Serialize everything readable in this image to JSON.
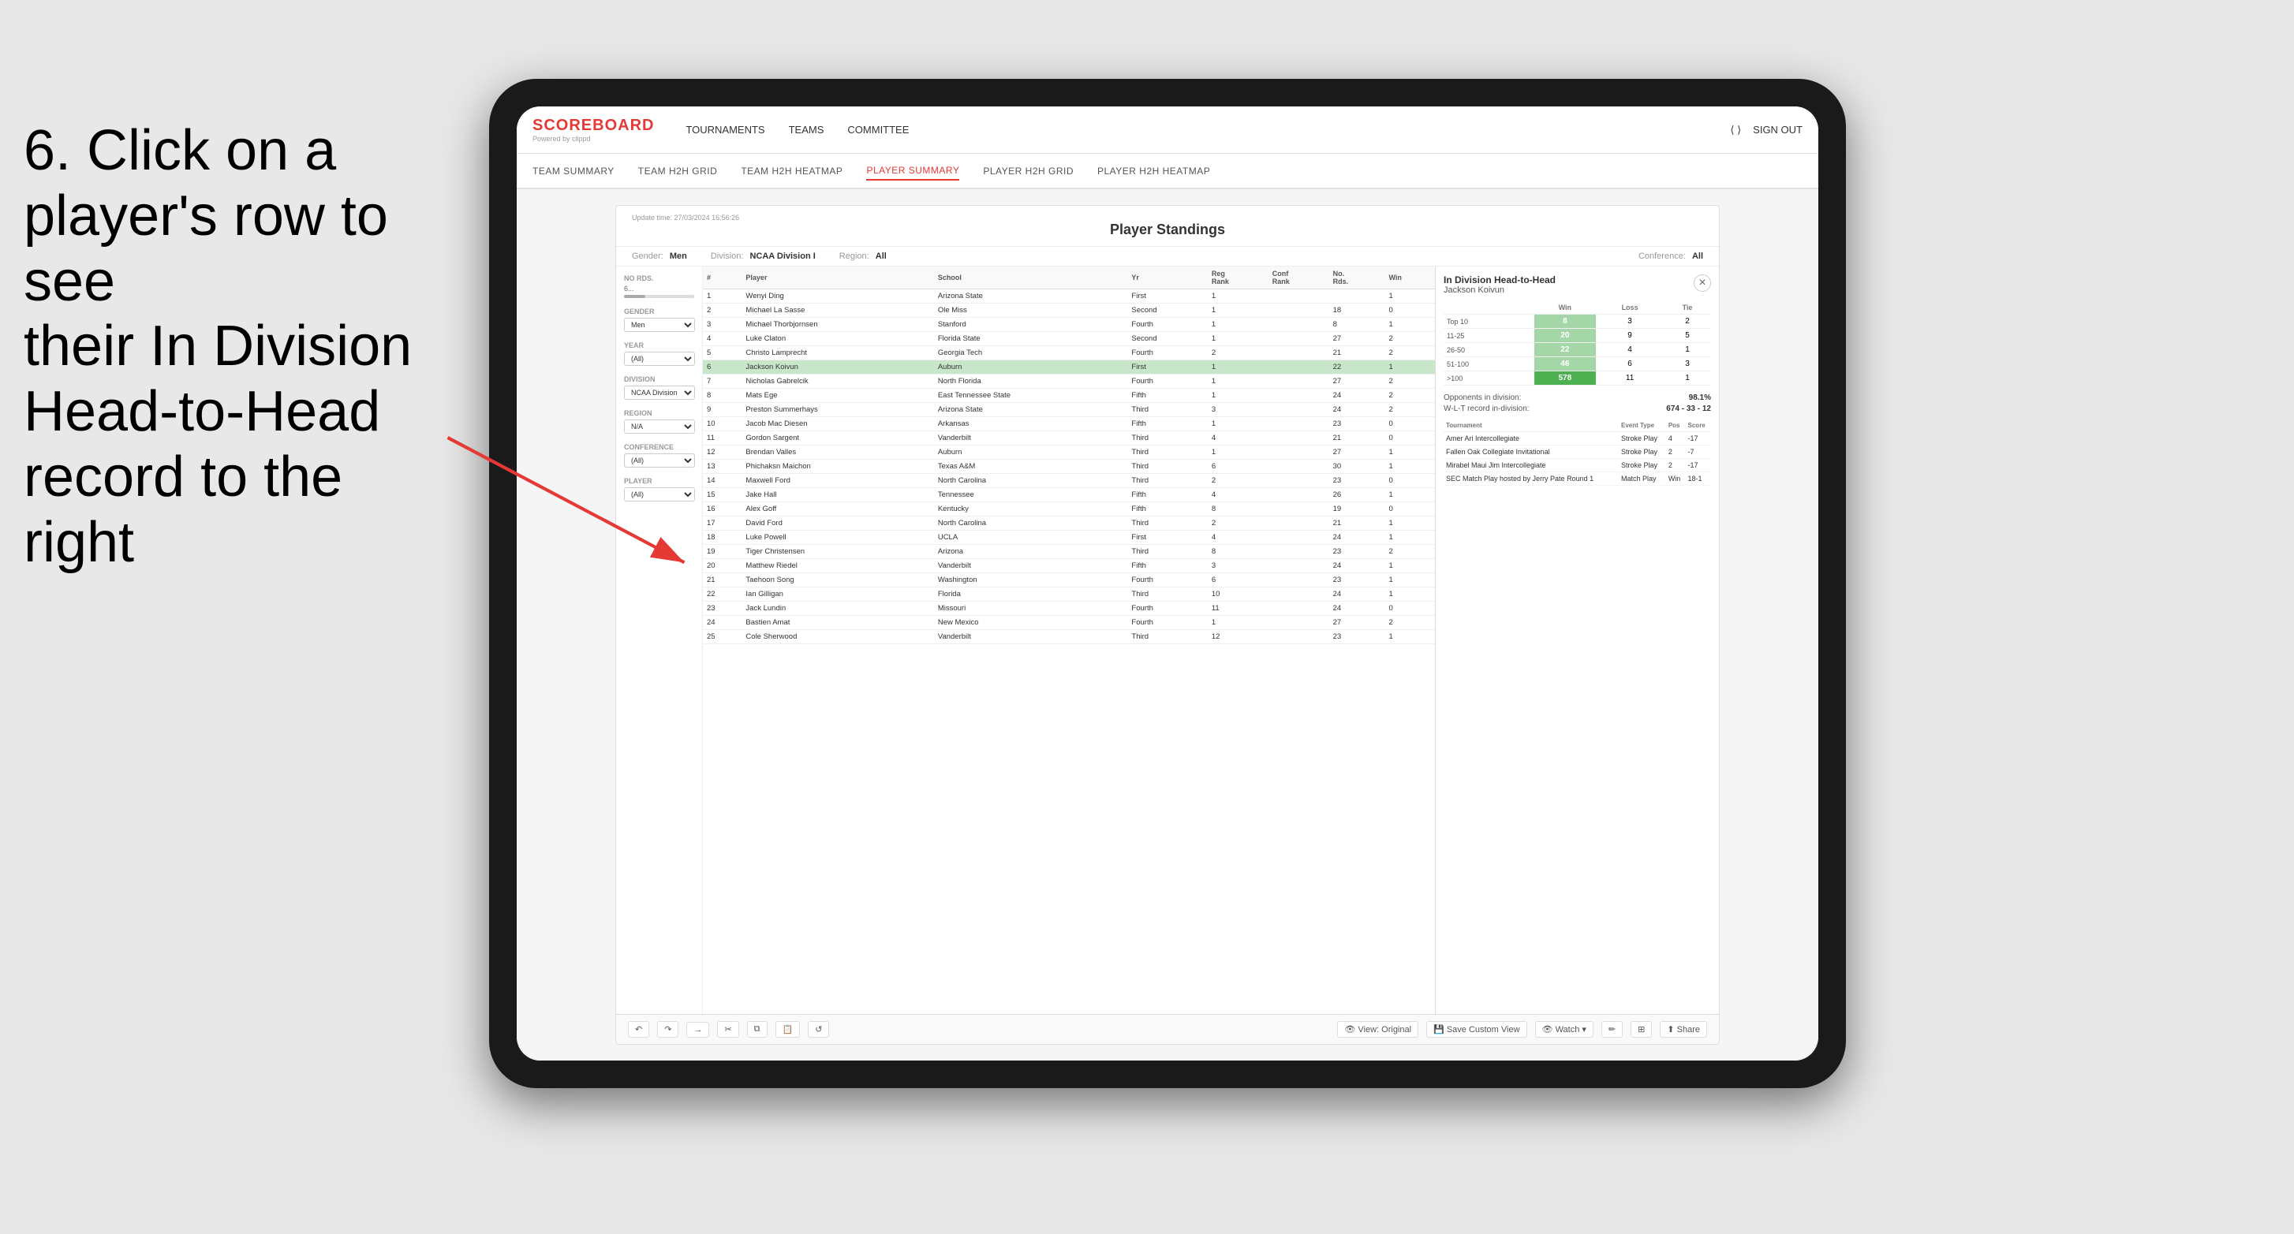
{
  "instruction": {
    "line1": "6. Click on a",
    "line2": "player's row to see",
    "line3": "their In Division",
    "line4": "Head-to-Head",
    "line5": "record to the right"
  },
  "scoreboard": {
    "title": "SCOREBOARD",
    "subtitle": "Powered by clippd"
  },
  "nav": {
    "links": [
      "TOURNAMENTS",
      "TEAMS",
      "COMMITTEE"
    ],
    "sign_out": "Sign out"
  },
  "sub_nav": {
    "links": [
      "TEAM SUMMARY",
      "TEAM H2H GRID",
      "TEAM H2H HEATMAP",
      "PLAYER SUMMARY",
      "PLAYER H2H GRID",
      "PLAYER H2H HEATMAP"
    ]
  },
  "panel": {
    "update_time_label": "Update time:",
    "update_time": "27/03/2024 16:56:26",
    "title": "Player Standings",
    "filters": {
      "gender_label": "Gender:",
      "gender": "Men",
      "division_label": "Division:",
      "division": "NCAA Division I",
      "region_label": "Region:",
      "region": "All",
      "conference_label": "Conference:",
      "conference": "All"
    }
  },
  "sidebar_filters": {
    "no_rds_label": "No Rds.",
    "no_rds_range": "6...",
    "gender_label": "Gender",
    "gender_value": "Men",
    "year_label": "Year",
    "year_value": "(All)",
    "division_label": "Division",
    "division_value": "NCAA Division I",
    "region_label": "Region",
    "region_value": "N/A",
    "conference_label": "Conference",
    "conference_value": "(All)",
    "player_label": "Player",
    "player_value": "(All)"
  },
  "table": {
    "headers": [
      "#",
      "Player",
      "School",
      "Yr",
      "Reg Rank",
      "Conf Rank",
      "No. Rds.",
      "Win"
    ],
    "rows": [
      {
        "rank": 1,
        "player": "Wenyi Ding",
        "school": "Arizona State",
        "yr": "First",
        "reg_rank": 1,
        "conf_rank": "",
        "no_rds": "",
        "win": 1
      },
      {
        "rank": 2,
        "player": "Michael La Sasse",
        "school": "Ole Miss",
        "yr": "Second",
        "reg_rank": 1,
        "conf_rank": "",
        "no_rds": 18,
        "win": 0
      },
      {
        "rank": 3,
        "player": "Michael Thorbjornsen",
        "school": "Stanford",
        "yr": "Fourth",
        "reg_rank": 1,
        "conf_rank": "",
        "no_rds": 8,
        "win": 1
      },
      {
        "rank": 4,
        "player": "Luke Claton",
        "school": "Florida State",
        "yr": "Second",
        "reg_rank": 1,
        "conf_rank": "",
        "no_rds": 27,
        "win": 2
      },
      {
        "rank": 5,
        "player": "Christo Lamprecht",
        "school": "Georgia Tech",
        "yr": "Fourth",
        "reg_rank": 2,
        "conf_rank": "",
        "no_rds": 21,
        "win": 2
      },
      {
        "rank": 6,
        "player": "Jackson Koivun",
        "school": "Auburn",
        "yr": "First",
        "reg_rank": 1,
        "conf_rank": "",
        "no_rds": 22,
        "win": 1
      },
      {
        "rank": 7,
        "player": "Nicholas Gabrelcik",
        "school": "North Florida",
        "yr": "Fourth",
        "reg_rank": 1,
        "conf_rank": "",
        "no_rds": 27,
        "win": 2
      },
      {
        "rank": 8,
        "player": "Mats Ege",
        "school": "East Tennessee State",
        "yr": "Fifth",
        "reg_rank": 1,
        "conf_rank": "",
        "no_rds": 24,
        "win": 2
      },
      {
        "rank": 9,
        "player": "Preston Summerhays",
        "school": "Arizona State",
        "yr": "Third",
        "reg_rank": 3,
        "conf_rank": "",
        "no_rds": 24,
        "win": 2
      },
      {
        "rank": 10,
        "player": "Jacob Mac Diesen",
        "school": "Arkansas",
        "yr": "Fifth",
        "reg_rank": 1,
        "conf_rank": "",
        "no_rds": 23,
        "win": 0
      },
      {
        "rank": 11,
        "player": "Gordon Sargent",
        "school": "Vanderbilt",
        "yr": "Third",
        "reg_rank": 4,
        "conf_rank": "",
        "no_rds": 21,
        "win": 0
      },
      {
        "rank": 12,
        "player": "Brendan Valles",
        "school": "Auburn",
        "yr": "Third",
        "reg_rank": 1,
        "conf_rank": "",
        "no_rds": 27,
        "win": 1
      },
      {
        "rank": 13,
        "player": "Phichaksn Maichon",
        "school": "Texas A&M",
        "yr": "Third",
        "reg_rank": 6,
        "conf_rank": "",
        "no_rds": 30,
        "win": 1
      },
      {
        "rank": 14,
        "player": "Maxwell Ford",
        "school": "North Carolina",
        "yr": "Third",
        "reg_rank": 2,
        "conf_rank": "",
        "no_rds": 23,
        "win": 0
      },
      {
        "rank": 15,
        "player": "Jake Hall",
        "school": "Tennessee",
        "yr": "Fifth",
        "reg_rank": 4,
        "conf_rank": "",
        "no_rds": 26,
        "win": 1
      },
      {
        "rank": 16,
        "player": "Alex Goff",
        "school": "Kentucky",
        "yr": "Fifth",
        "reg_rank": 8,
        "conf_rank": "",
        "no_rds": 19,
        "win": 0
      },
      {
        "rank": 17,
        "player": "David Ford",
        "school": "North Carolina",
        "yr": "Third",
        "reg_rank": 2,
        "conf_rank": "",
        "no_rds": 21,
        "win": 1
      },
      {
        "rank": 18,
        "player": "Luke Powell",
        "school": "UCLA",
        "yr": "First",
        "reg_rank": 4,
        "conf_rank": "",
        "no_rds": 24,
        "win": 1
      },
      {
        "rank": 19,
        "player": "Tiger Christensen",
        "school": "Arizona",
        "yr": "Third",
        "reg_rank": 8,
        "conf_rank": "",
        "no_rds": 23,
        "win": 2
      },
      {
        "rank": 20,
        "player": "Matthew Riedel",
        "school": "Vanderbilt",
        "yr": "Fifth",
        "reg_rank": 3,
        "conf_rank": "",
        "no_rds": 24,
        "win": 1
      },
      {
        "rank": 21,
        "player": "Taehoon Song",
        "school": "Washington",
        "yr": "Fourth",
        "reg_rank": 6,
        "conf_rank": "",
        "no_rds": 23,
        "win": 1
      },
      {
        "rank": 22,
        "player": "Ian Gilligan",
        "school": "Florida",
        "yr": "Third",
        "reg_rank": 10,
        "conf_rank": "",
        "no_rds": 24,
        "win": 1
      },
      {
        "rank": 23,
        "player": "Jack Lundin",
        "school": "Missouri",
        "yr": "Fourth",
        "reg_rank": 11,
        "conf_rank": "",
        "no_rds": 24,
        "win": 0
      },
      {
        "rank": 24,
        "player": "Bastien Amat",
        "school": "New Mexico",
        "yr": "Fourth",
        "reg_rank": 1,
        "conf_rank": "",
        "no_rds": 27,
        "win": 2
      },
      {
        "rank": 25,
        "player": "Cole Sherwood",
        "school": "Vanderbilt",
        "yr": "Third",
        "reg_rank": 12,
        "conf_rank": "",
        "no_rds": 23,
        "win": 1
      }
    ]
  },
  "h2h": {
    "title": "In Division Head-to-Head",
    "player_name": "Jackson Koivun",
    "close_label": "×",
    "table_headers": [
      "",
      "Win",
      "Loss",
      "Tie"
    ],
    "rows": [
      {
        "label": "Top 10",
        "win": 8,
        "loss": 3,
        "tie": 2
      },
      {
        "label": "11-25",
        "win": 20,
        "loss": 9,
        "tie": 5
      },
      {
        "label": "26-50",
        "win": 22,
        "loss": 4,
        "tie": 1
      },
      {
        "label": "51-100",
        "win": 46,
        "loss": 6,
        "tie": 3
      },
      {
        "label": ">100",
        "win": 578,
        "loss": 11,
        "tie": 1
      }
    ],
    "opponents_label": "Opponents in division:",
    "opponents_value": "98.1%",
    "wlt_label": "W-L-T record in-division:",
    "wlt_value": "674 - 33 - 12",
    "tournament_headers": [
      "Tournament",
      "Event Type",
      "Pos",
      "Score"
    ],
    "tournaments": [
      {
        "name": "Amer Ari Intercollegiate",
        "type": "Stroke Play",
        "pos": 4,
        "score": "-17"
      },
      {
        "name": "Fallen Oak Collegiate Invitational",
        "type": "Stroke Play",
        "pos": 2,
        "score": "-7"
      },
      {
        "name": "Mirabel Maui Jim Intercollegiate",
        "type": "Stroke Play",
        "pos": 2,
        "score": "-17"
      },
      {
        "name": "SEC Match Play hosted by Jerry Pate Round 1",
        "type": "Match Play",
        "pos": "Win",
        "score": "18-1"
      }
    ]
  },
  "toolbar": {
    "undo": "↶",
    "redo": "↷",
    "forward": "→",
    "view_original": "View: Original",
    "save_custom_view": "Save Custom View",
    "watch": "Watch ▾",
    "share": "Share"
  }
}
